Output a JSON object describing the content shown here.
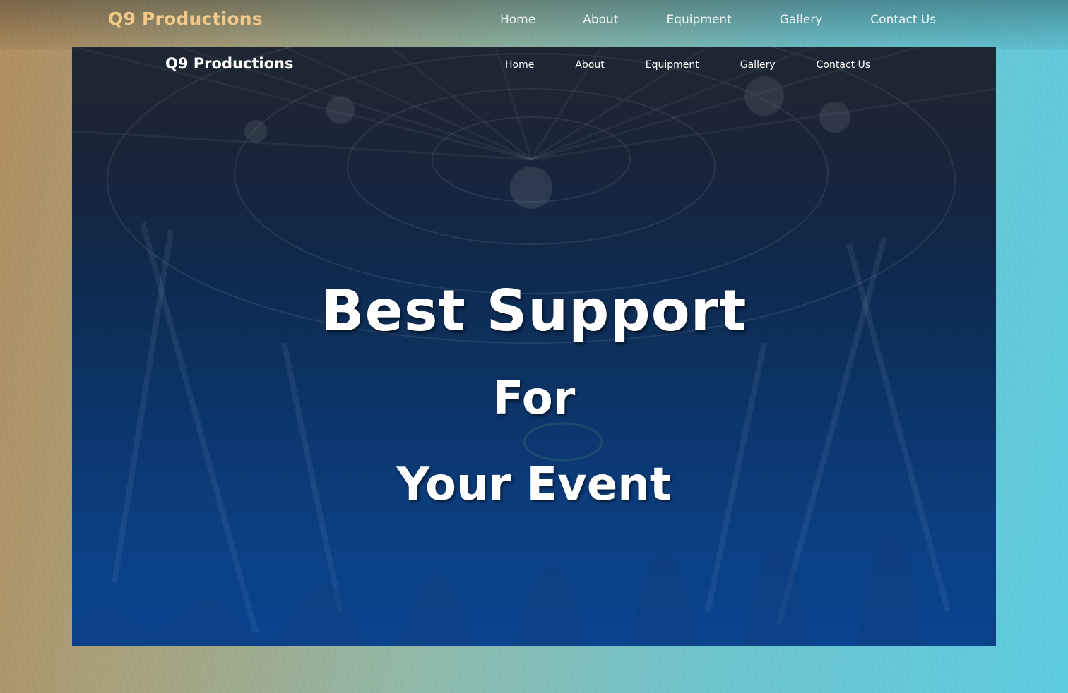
{
  "outer_nav": {
    "logo": "Q9 Productions",
    "links": [
      "Home",
      "About",
      "Equipment",
      "Gallery",
      "Contact Us"
    ]
  },
  "inner_nav": {
    "logo": "Q9 Productions",
    "links": [
      "Home",
      "About",
      "Equipment",
      "Gallery",
      "Contact Us"
    ]
  },
  "hero": {
    "line1": "Best Support",
    "line2": "For",
    "line3": "Your Event"
  },
  "colors": {
    "outer_logo": "#f3c98a",
    "frame_top": "#1c2634",
    "frame_bottom": "#0a4590",
    "text": "#ffffff"
  }
}
